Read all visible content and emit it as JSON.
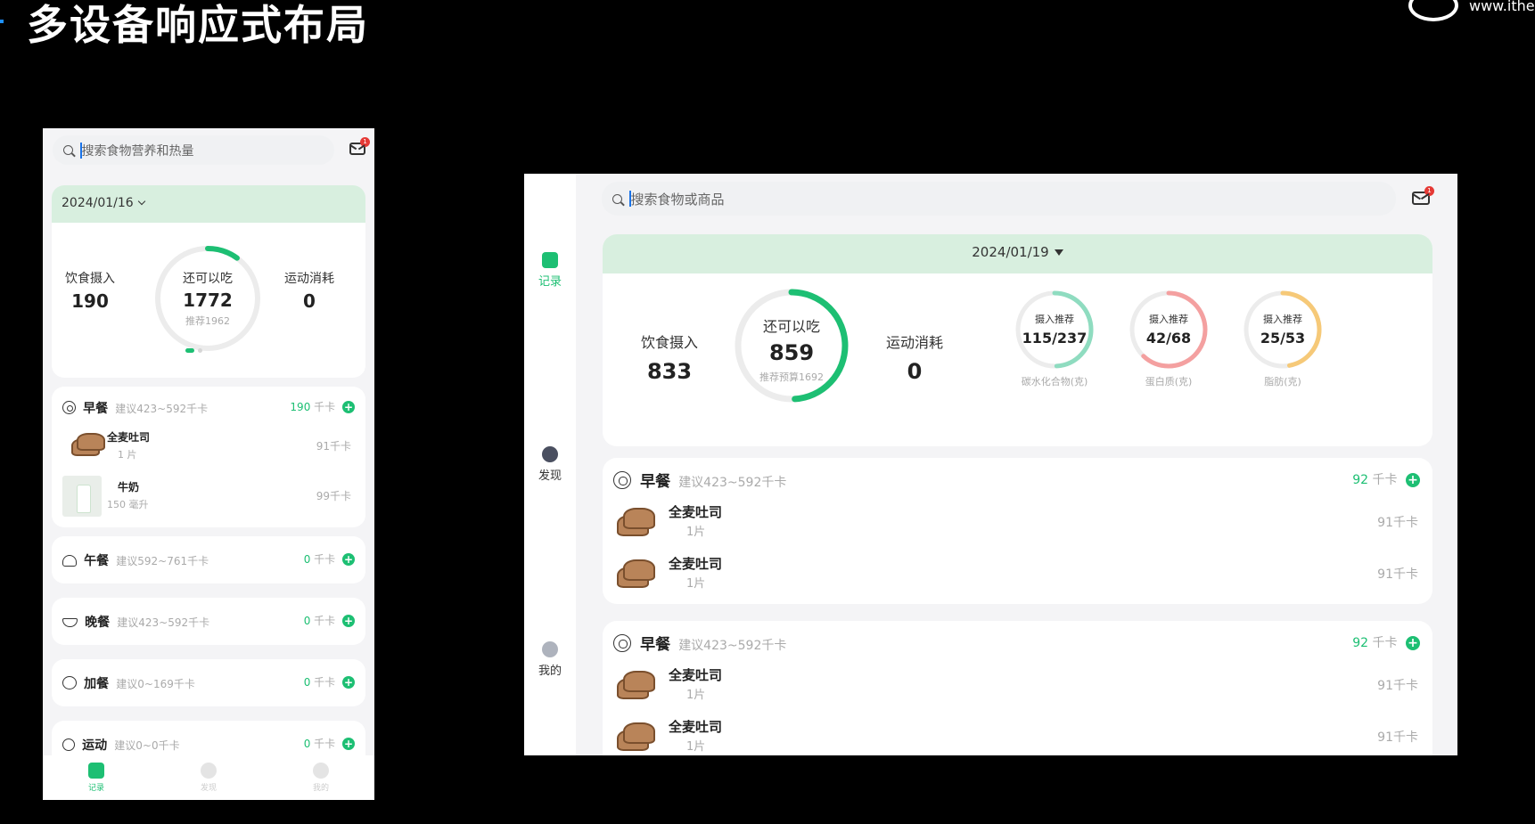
{
  "slide": {
    "title": "多设备响应式布局",
    "brand_url": "www.itheir"
  },
  "phone": {
    "search_placeholder": "搜索食物营养和热量",
    "mail_badge": "1",
    "date": "2024/01/16",
    "intake": {
      "label": "饮食摄入",
      "value": "190"
    },
    "remaining": {
      "label": "还可以吃",
      "value": "1772",
      "sub": "推荐1962",
      "progress": 0.1
    },
    "exercise": {
      "label": "运动消耗",
      "value": "0"
    },
    "meals": [
      {
        "name": "早餐",
        "suggest": "建议423~592千卡",
        "kcal": "190",
        "unit": "千卡",
        "foods": [
          {
            "name": "全麦吐司",
            "qty": "1 片",
            "kcal": "91千卡"
          },
          {
            "name": "牛奶",
            "qty": "150 毫升",
            "kcal": "99千卡"
          }
        ]
      },
      {
        "name": "午餐",
        "suggest": "建议592~761千卡",
        "kcal": "0",
        "unit": "千卡"
      },
      {
        "name": "晚餐",
        "suggest": "建议423~592千卡",
        "kcal": "0",
        "unit": "千卡"
      },
      {
        "name": "加餐",
        "suggest": "建议0~169千卡",
        "kcal": "0",
        "unit": "千卡"
      },
      {
        "name": "运动",
        "suggest": "建议0~0千卡",
        "kcal": "0",
        "unit": "千卡"
      }
    ],
    "tabs": [
      {
        "label": "记录"
      },
      {
        "label": "发现"
      },
      {
        "label": "我的"
      }
    ]
  },
  "tablet": {
    "search_placeholder": "搜索食物或商品",
    "mail_badge": "1",
    "rail": [
      {
        "label": "记录"
      },
      {
        "label": "发现"
      },
      {
        "label": "我的"
      }
    ],
    "date": "2024/01/19",
    "intake": {
      "label": "饮食摄入",
      "value": "833"
    },
    "remaining": {
      "label": "还可以吃",
      "value": "859",
      "sub": "推荐预算1692",
      "progress": 0.49
    },
    "exercise": {
      "label": "运动消耗",
      "value": "0"
    },
    "macros": [
      {
        "label": "摄入推荐",
        "value": "115/237",
        "name": "碳水化合物(克)",
        "progress": 0.49,
        "color": "#8fdcc0"
      },
      {
        "label": "摄入推荐",
        "value": "42/68",
        "name": "蛋白质(克)",
        "progress": 0.62,
        "color": "#f4a0a0"
      },
      {
        "label": "摄入推荐",
        "value": "25/53",
        "name": "脂肪(克)",
        "progress": 0.47,
        "color": "#f6c978"
      }
    ],
    "meals": [
      {
        "name": "早餐",
        "suggest": "建议423~592千卡",
        "kcal": "92",
        "unit": "千卡",
        "foods": [
          {
            "name": "全麦吐司",
            "qty": "1片",
            "kcal": "91千卡"
          },
          {
            "name": "全麦吐司",
            "qty": "1片",
            "kcal": "91千卡"
          }
        ]
      },
      {
        "name": "早餐",
        "suggest": "建议423~592千卡",
        "kcal": "92",
        "unit": "千卡",
        "foods": [
          {
            "name": "全麦吐司",
            "qty": "1片",
            "kcal": "91千卡"
          },
          {
            "name": "全麦吐司",
            "qty": "1片",
            "kcal": "91千卡"
          }
        ]
      }
    ]
  },
  "colors": {
    "accent": "#1dbf73",
    "date_bar": "#d8efdf",
    "badge": "#e53935"
  }
}
